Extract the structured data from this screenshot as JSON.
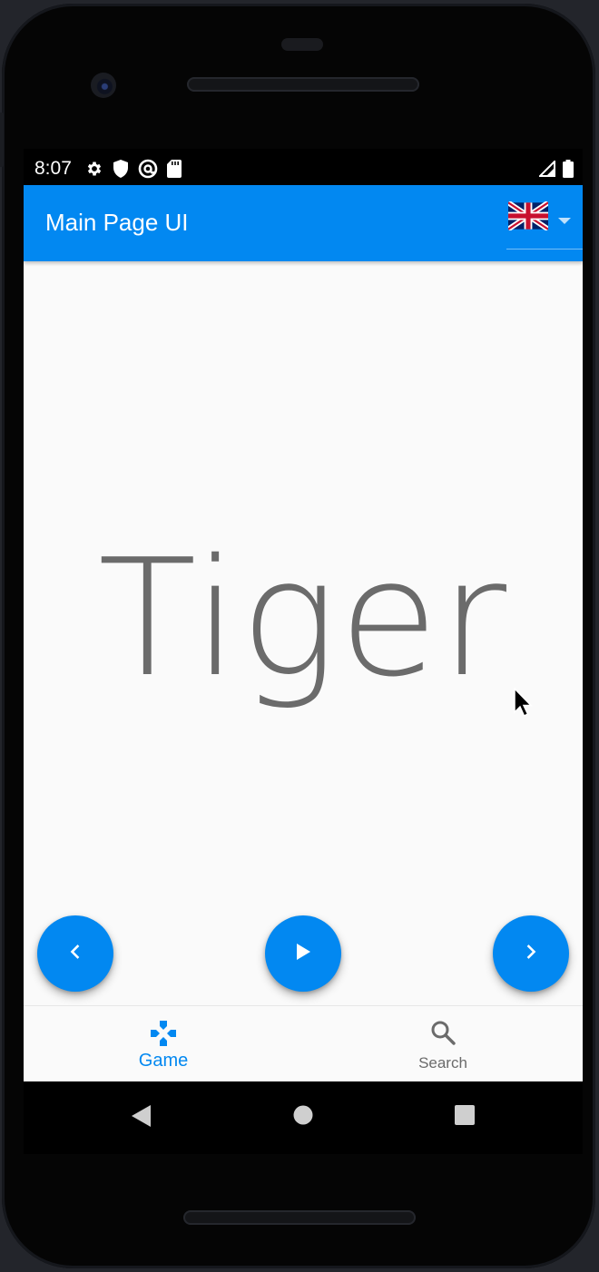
{
  "status_bar": {
    "time": "8:07",
    "icons_left": [
      "gear-icon",
      "shield-icon",
      "at-sign-icon",
      "sd-card-icon"
    ],
    "icons_right": [
      "cellular-signal-icon",
      "battery-icon"
    ]
  },
  "app_bar": {
    "title": "Main Page UI",
    "language_selector": {
      "selected_flag": "uk-flag-icon",
      "caret": "arrow-drop-down-icon"
    }
  },
  "main": {
    "word": "Tiger",
    "controls": {
      "previous_icon": "chevron-left-icon",
      "play_icon": "play-icon",
      "next_icon": "chevron-right-icon"
    }
  },
  "bottom_nav": {
    "items": [
      {
        "label": "Game",
        "icon": "gamepad-icon",
        "active": true
      },
      {
        "label": "Search",
        "icon": "search-icon",
        "active": false
      }
    ]
  },
  "system_nav": {
    "buttons": [
      "back-icon",
      "home-icon",
      "recents-icon"
    ]
  },
  "colors": {
    "primary": "#0288f1",
    "background": "#fafafa",
    "word_text": "#6b6b6b",
    "inactive_nav": "#6b6b6b"
  }
}
